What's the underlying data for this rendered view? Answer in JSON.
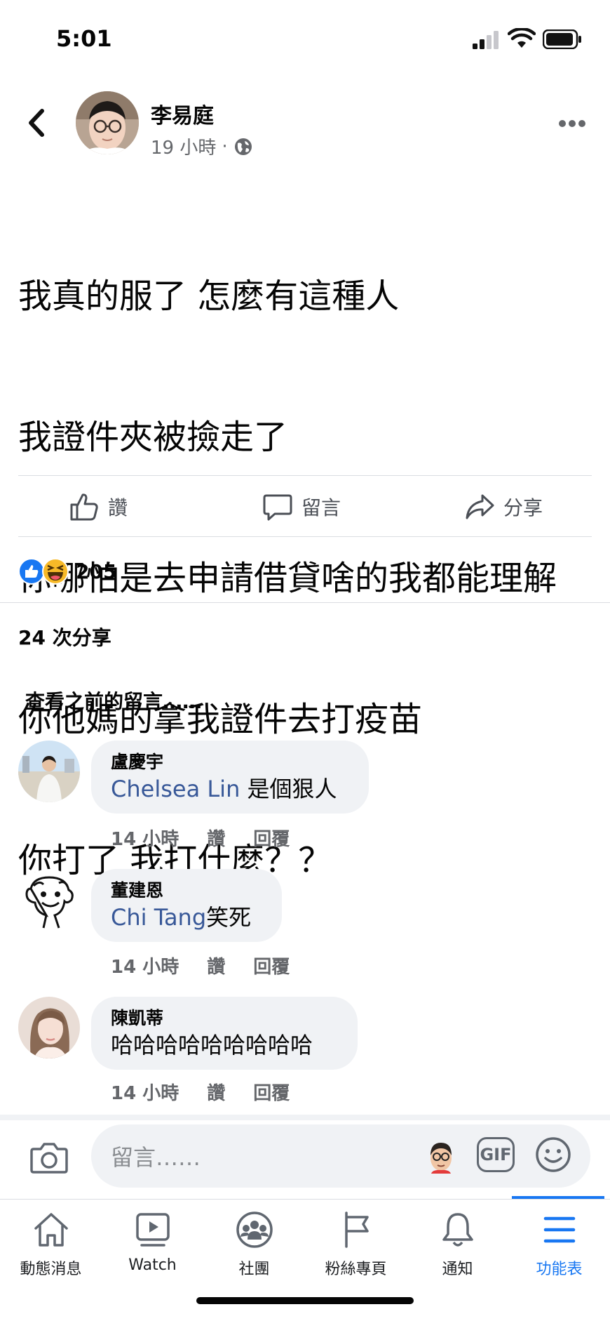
{
  "status_bar": {
    "time": "5:01"
  },
  "post": {
    "author": "李易庭",
    "time": "19 小時",
    "separator": "·",
    "text_lines": [
      "我真的服了 怎麼有這種人",
      "我證件夾被撿走了",
      "你哪怕是去申請借貸啥的我都能理解",
      "你他媽的拿我證件去打疫苗",
      "你打了 我打什麼？？"
    ],
    "actions": {
      "like": "讚",
      "comment": "留言",
      "share": "分享"
    },
    "reaction_count": "205",
    "shares": "24 次分享"
  },
  "view_previous": "查看之前的留言……",
  "comments": [
    {
      "name": "盧慶宇",
      "mention": "Chelsea Lin",
      "text": " 是個狠人",
      "time": "14 小時",
      "like": "讚",
      "reply": "回覆"
    },
    {
      "name": "董建恩",
      "mention": "Chi Tang",
      "text": "笑死",
      "time": "14 小時",
      "like": "讚",
      "reply": "回覆"
    },
    {
      "name": "陳凱蒂",
      "mention": "",
      "text": "哈哈哈哈哈哈哈哈哈",
      "time": "14 小時",
      "like": "讚",
      "reply": "回覆"
    }
  ],
  "composer": {
    "placeholder": "留言……",
    "gif": "GIF"
  },
  "nav": {
    "items": [
      {
        "label": "動態消息",
        "icon": "home-icon"
      },
      {
        "label": "Watch",
        "icon": "watch-icon"
      },
      {
        "label": "社團",
        "icon": "groups-icon"
      },
      {
        "label": "粉絲專頁",
        "icon": "flag-icon"
      },
      {
        "label": "通知",
        "icon": "bell-icon"
      },
      {
        "label": "功能表",
        "icon": "menu-icon"
      }
    ],
    "active": "功能表"
  },
  "colors": {
    "link": "#385898",
    "active": "#1877f2",
    "like_blue": "#1877f2",
    "haha_yellow": "#f7b928"
  }
}
